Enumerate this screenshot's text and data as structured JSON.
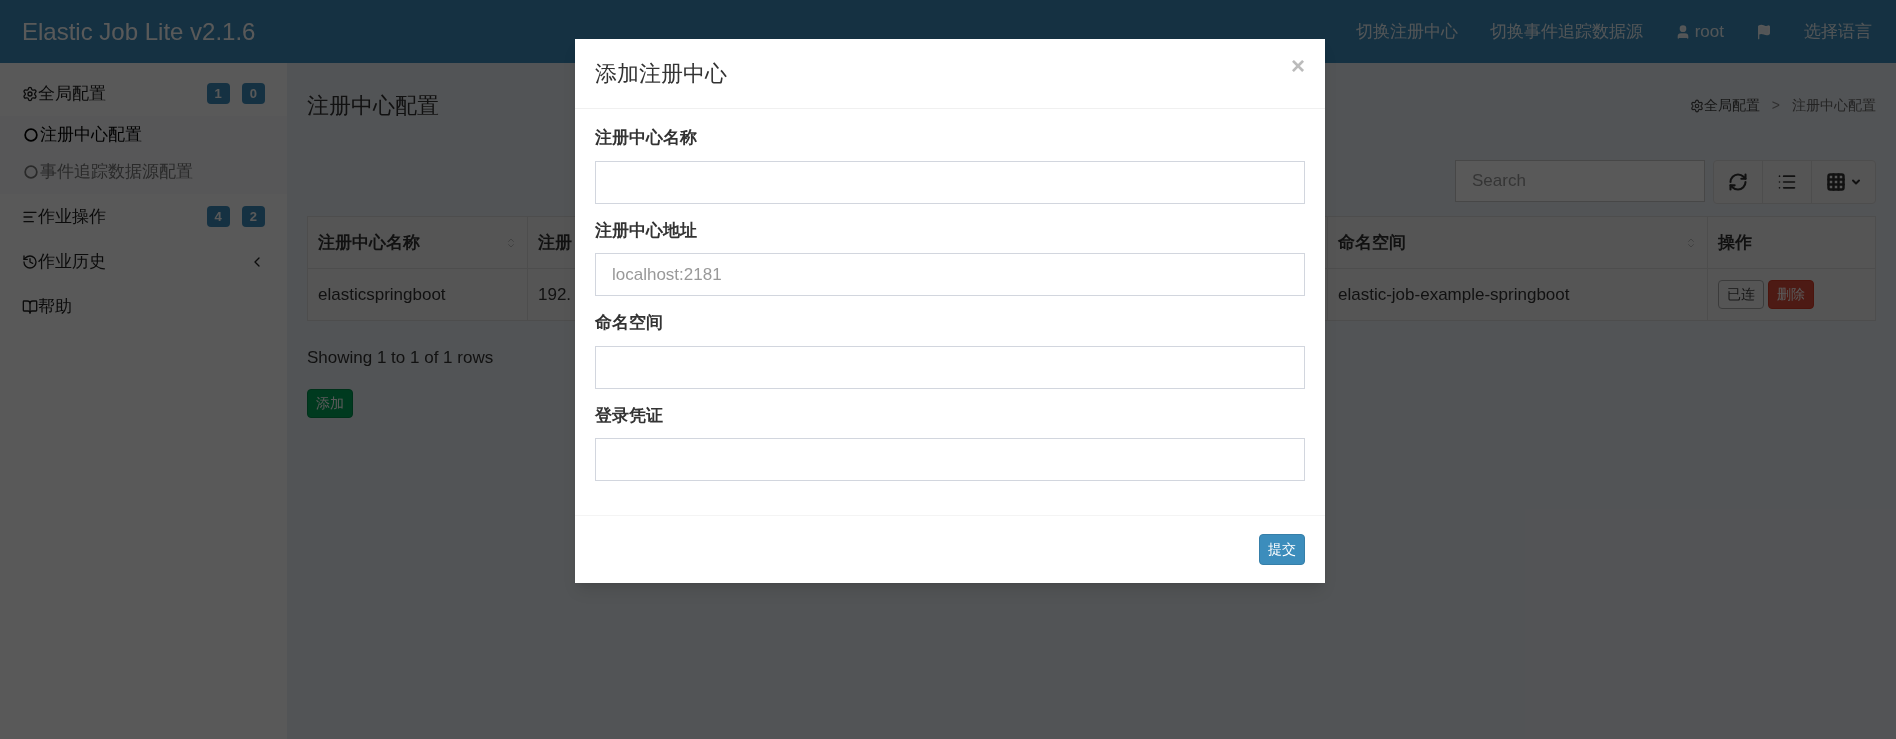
{
  "header": {
    "title": "Elastic Job Lite v2.1.6",
    "nav": [
      {
        "kind": "text",
        "label": "切换注册中心"
      },
      {
        "kind": "text",
        "label": "切换事件追踪数据源"
      },
      {
        "kind": "user",
        "label": "root"
      },
      {
        "kind": "flag"
      },
      {
        "kind": "text",
        "label": "选择语言"
      }
    ]
  },
  "sidebar": {
    "items": [
      {
        "label": "全局配置",
        "badges": [
          "1",
          "0"
        ],
        "children": [
          {
            "label": "注册中心配置",
            "selected": true
          },
          {
            "label": "事件追踪数据源配置",
            "selected": false
          }
        ]
      },
      {
        "label": "作业操作",
        "badges": [
          "4",
          "2"
        ]
      },
      {
        "label": "作业历史",
        "expanded": false
      },
      {
        "label": "帮助"
      }
    ]
  },
  "page": {
    "title": "注册中心配置",
    "breadcrumb": [
      "全局配置",
      "注册中心配置"
    ],
    "breadcrumb_separator": ">"
  },
  "toolbar": {
    "search": {
      "placeholder": "Search"
    }
  },
  "table": {
    "columns": [
      {
        "label": "注册中心名称",
        "sortable": true
      },
      {
        "label": "注册"
      },
      {
        "label": "命名空间",
        "sortable": true
      },
      {
        "label": "操作",
        "sortable": false
      }
    ],
    "rows": [
      {
        "cells": [
          "elasticspringboot",
          "192.",
          "elastic-job-example-springboot"
        ],
        "actions": [
          {
            "kind": "default",
            "label": "已连"
          },
          {
            "kind": "danger",
            "label": "删除"
          }
        ]
      }
    ]
  },
  "pagination": {
    "summary": "Showing 1 to 1 of 1 rows"
  },
  "add_button": "添加",
  "modal": {
    "title": "添加注册中心",
    "close": "×",
    "fields": [
      {
        "label": "注册中心名称"
      },
      {
        "label": "注册中心地址",
        "placeholder": "localhost:2181"
      },
      {
        "label": "命名空间"
      },
      {
        "label": "登录凭证"
      }
    ],
    "submit": "提交"
  }
}
